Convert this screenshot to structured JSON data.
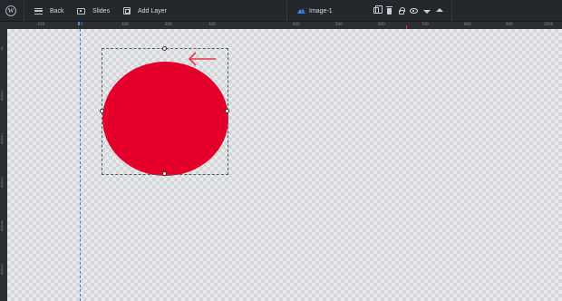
{
  "toolbar": {
    "logo": "W",
    "back_label": "Back",
    "slides_label": "Slides",
    "add_layer_label": "Add Layer",
    "layer_name": "Image-1"
  },
  "ruler": {
    "top_labels": [
      "-100",
      "0",
      "100",
      "200",
      "300",
      "400",
      "500",
      "600",
      "700",
      "800",
      "900",
      "1000",
      "1100"
    ],
    "left_labels": [
      "0",
      "100",
      "200",
      "300",
      "400",
      "500"
    ]
  },
  "canvas": {
    "shape_color": "#e4002b",
    "arrow_color": "#e8344e",
    "guide_color": "#3b7de0"
  },
  "icons": [
    "wordpress-icon",
    "menu-icon",
    "slides-icon",
    "add-layer-icon",
    "image-layer-icon",
    "duplicate-icon",
    "trash-icon",
    "lock-icon",
    "eye-icon",
    "chevron-down-icon",
    "chevron-up-icon",
    "arrow-left-icon"
  ]
}
